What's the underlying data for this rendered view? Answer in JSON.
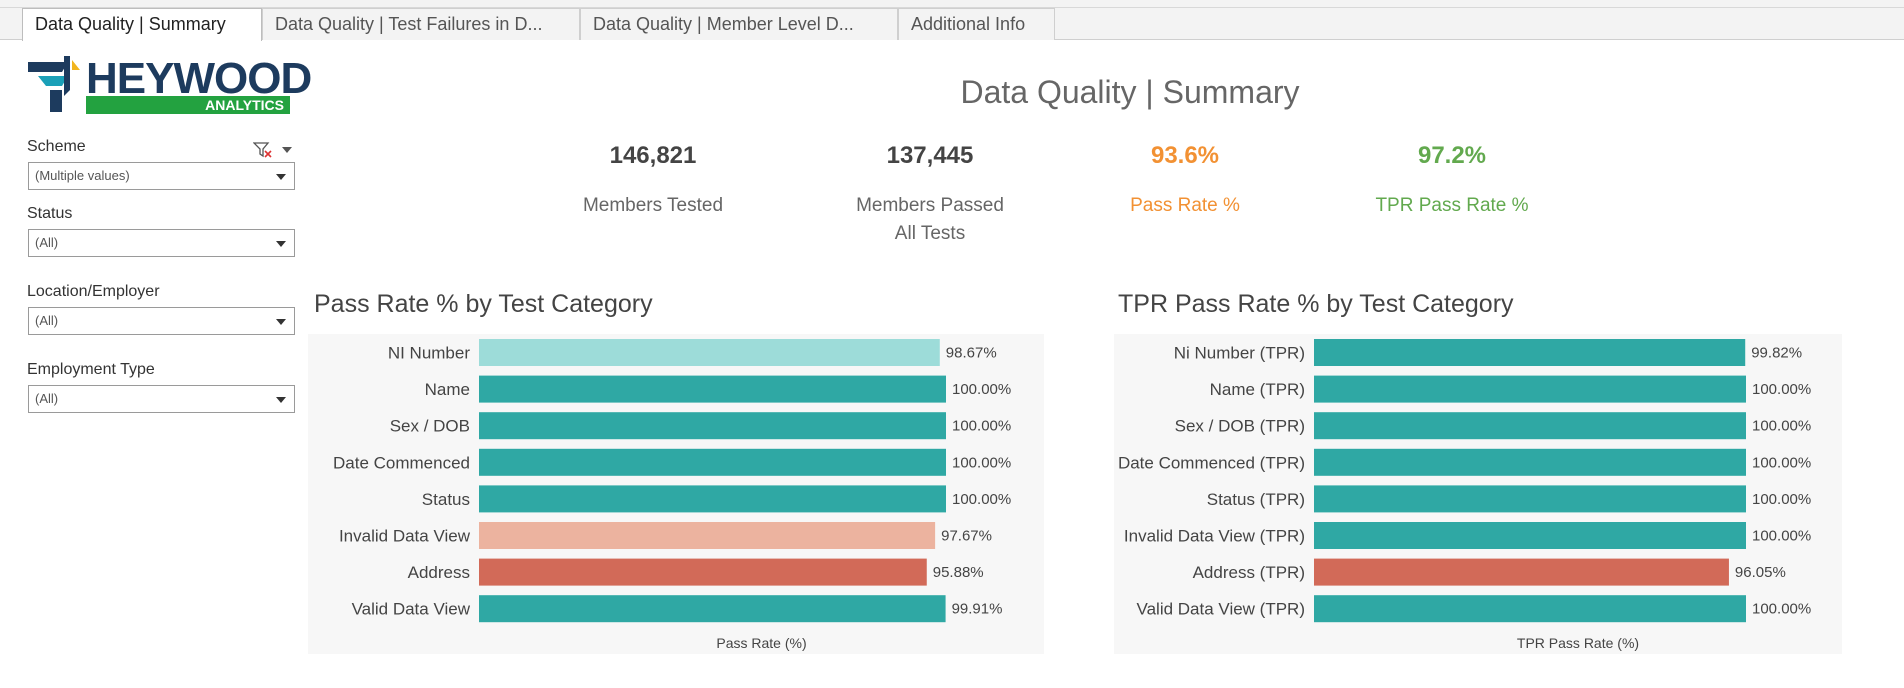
{
  "tabs": [
    {
      "label": "Data Quality | Summary",
      "active": true
    },
    {
      "label": "Data Quality | Test Failures in D...",
      "active": false
    },
    {
      "label": "Data Quality | Member Level D...",
      "active": false
    },
    {
      "label": "Additional Info",
      "active": false
    }
  ],
  "logo": {
    "name": "HEYWOOD",
    "sub": "ANALYTICS"
  },
  "filters": {
    "scheme": {
      "label": "Scheme",
      "value": "(Multiple values)"
    },
    "status": {
      "label": "Status",
      "value": "(All)"
    },
    "location": {
      "label": "Location/Employer",
      "value": "(All)"
    },
    "employment": {
      "label": "Employment Type",
      "value": "(All)"
    }
  },
  "title": "Data Quality | Summary",
  "kpis": {
    "members_tested": {
      "value": "146,821",
      "label": "Members Tested"
    },
    "members_passed": {
      "value": "137,445",
      "label_line1": "Members Passed",
      "label_line2": "All Tests"
    },
    "pass_rate": {
      "value": "93.6%",
      "label": "Pass Rate %"
    },
    "tpr_pass_rate": {
      "value": "97.2%",
      "label": "TPR Pass Rate %"
    }
  },
  "colors": {
    "teal": "#2fa8a4",
    "light_teal": "#9ddcd9",
    "light_salmon": "#ecb39f",
    "salmon": "#d26a58",
    "orange": "#f29133",
    "green": "#62a94e"
  },
  "chart_data": [
    {
      "type": "bar",
      "orientation": "horizontal",
      "title": "Pass Rate % by Test Category",
      "xlabel": "Pass Rate (%)",
      "xlim": [
        0,
        100
      ],
      "categories": [
        "NI Number",
        "Name",
        "Sex / DOB",
        "Date Commenced",
        "Status",
        "Invalid Data View",
        "Address",
        "Valid Data View"
      ],
      "values": [
        98.67,
        100.0,
        100.0,
        100.0,
        100.0,
        97.67,
        95.88,
        99.91
      ],
      "labels": [
        "98.67%",
        "100.00%",
        "100.00%",
        "100.00%",
        "100.00%",
        "97.67%",
        "95.88%",
        "99.91%"
      ],
      "colors": [
        "#9ddcd9",
        "#2fa8a4",
        "#2fa8a4",
        "#2fa8a4",
        "#2fa8a4",
        "#ecb39f",
        "#d26a58",
        "#2fa8a4"
      ]
    },
    {
      "type": "bar",
      "orientation": "horizontal",
      "title": "TPR Pass Rate % by Test Category",
      "xlabel": "TPR Pass Rate (%)",
      "xlim": [
        0,
        100
      ],
      "categories": [
        "Ni Number (TPR)",
        "Name (TPR)",
        "Sex / DOB (TPR)",
        "Date Commenced (TPR)",
        "Status (TPR)",
        "Invalid Data View (TPR)",
        "Address (TPR)",
        "Valid Data View (TPR)"
      ],
      "values": [
        99.82,
        100.0,
        100.0,
        100.0,
        100.0,
        100.0,
        96.05,
        100.0
      ],
      "labels": [
        "99.82%",
        "100.00%",
        "100.00%",
        "100.00%",
        "100.00%",
        "100.00%",
        "96.05%",
        "100.00%"
      ],
      "colors": [
        "#2fa8a4",
        "#2fa8a4",
        "#2fa8a4",
        "#2fa8a4",
        "#2fa8a4",
        "#2fa8a4",
        "#d26a58",
        "#2fa8a4"
      ]
    }
  ]
}
